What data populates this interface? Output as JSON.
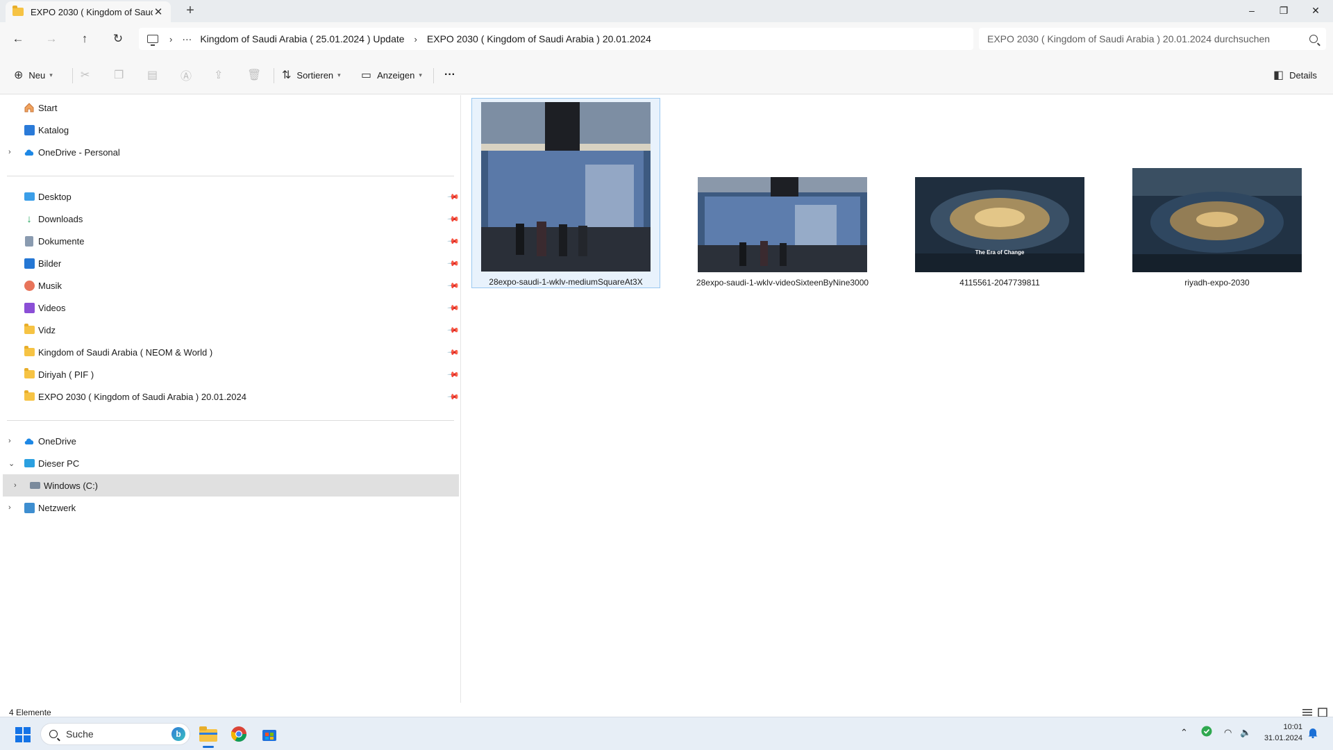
{
  "window": {
    "tab_title": "EXPO 2030 ( Kingdom of Saud",
    "new_tab": "+",
    "minimize": "–",
    "restore": "❐",
    "close": "✕"
  },
  "nav": {
    "back": "←",
    "forward": "→",
    "up": "↑",
    "refresh": "↻"
  },
  "address": {
    "more": "···",
    "segments": [
      "Kingdom of Saudi Arabia ( 25.01.2024 ) Update",
      "EXPO 2030 ( Kingdom of Saudi Arabia ) 20.01.2024"
    ],
    "chevron": "›"
  },
  "search": {
    "placeholder": "EXPO 2030 ( Kingdom of Saudi Arabia ) 20.01.2024 durchsuchen"
  },
  "toolbar": {
    "new_label": "Neu",
    "sort_label": "Sortieren",
    "view_label": "Anzeigen",
    "more": "···",
    "details_label": "Details"
  },
  "sidebar": {
    "top": [
      {
        "label": "Start",
        "icon": "home-icon"
      },
      {
        "label": "Katalog",
        "icon": "gallery-icon"
      },
      {
        "label": "OneDrive - Personal",
        "icon": "cloud-icon"
      }
    ],
    "pinned": [
      {
        "label": "Desktop",
        "icon": "desktop-icon"
      },
      {
        "label": "Downloads",
        "icon": "download-icon"
      },
      {
        "label": "Dokumente",
        "icon": "document-icon"
      },
      {
        "label": "Bilder",
        "icon": "pictures-icon"
      },
      {
        "label": "Musik",
        "icon": "music-icon"
      },
      {
        "label": "Videos",
        "icon": "videos-icon"
      },
      {
        "label": "Vidz",
        "icon": "folder-icon"
      },
      {
        "label": "Kingdom of Saudi Arabia ( NEOM & World  )",
        "icon": "folder-icon"
      },
      {
        "label": "Diriyah ( PIF )",
        "icon": "folder-icon"
      },
      {
        "label": "EXPO 2030 ( Kingdom of Saudi Arabia ) 20.01.2024",
        "icon": "folder-icon"
      }
    ],
    "bottom": [
      {
        "label": "OneDrive",
        "icon": "cloud-icon"
      },
      {
        "label": "Dieser PC",
        "icon": "pc-icon"
      },
      {
        "label": "Windows (C:)",
        "icon": "drive-icon"
      },
      {
        "label": "Netzwerk",
        "icon": "network-icon"
      }
    ]
  },
  "files": [
    {
      "name": "28expo-saudi-1-wklv-mediumSquareAt3X"
    },
    {
      "name": "28expo-saudi-1-wklv-videoSixteenByNine3000"
    },
    {
      "name": "4115561-2047739811",
      "overlay": "The Era of Change"
    },
    {
      "name": "riyadh-expo-2030"
    }
  ],
  "status": {
    "count": "4 Elemente"
  },
  "taskbar": {
    "search_label": "Suche",
    "bing": "b",
    "time": "10:01",
    "date": "31.01.2024"
  },
  "colors": {
    "accent": "#1a6fd6",
    "folder": "#f6c344",
    "selection": "#e8f2fc"
  }
}
